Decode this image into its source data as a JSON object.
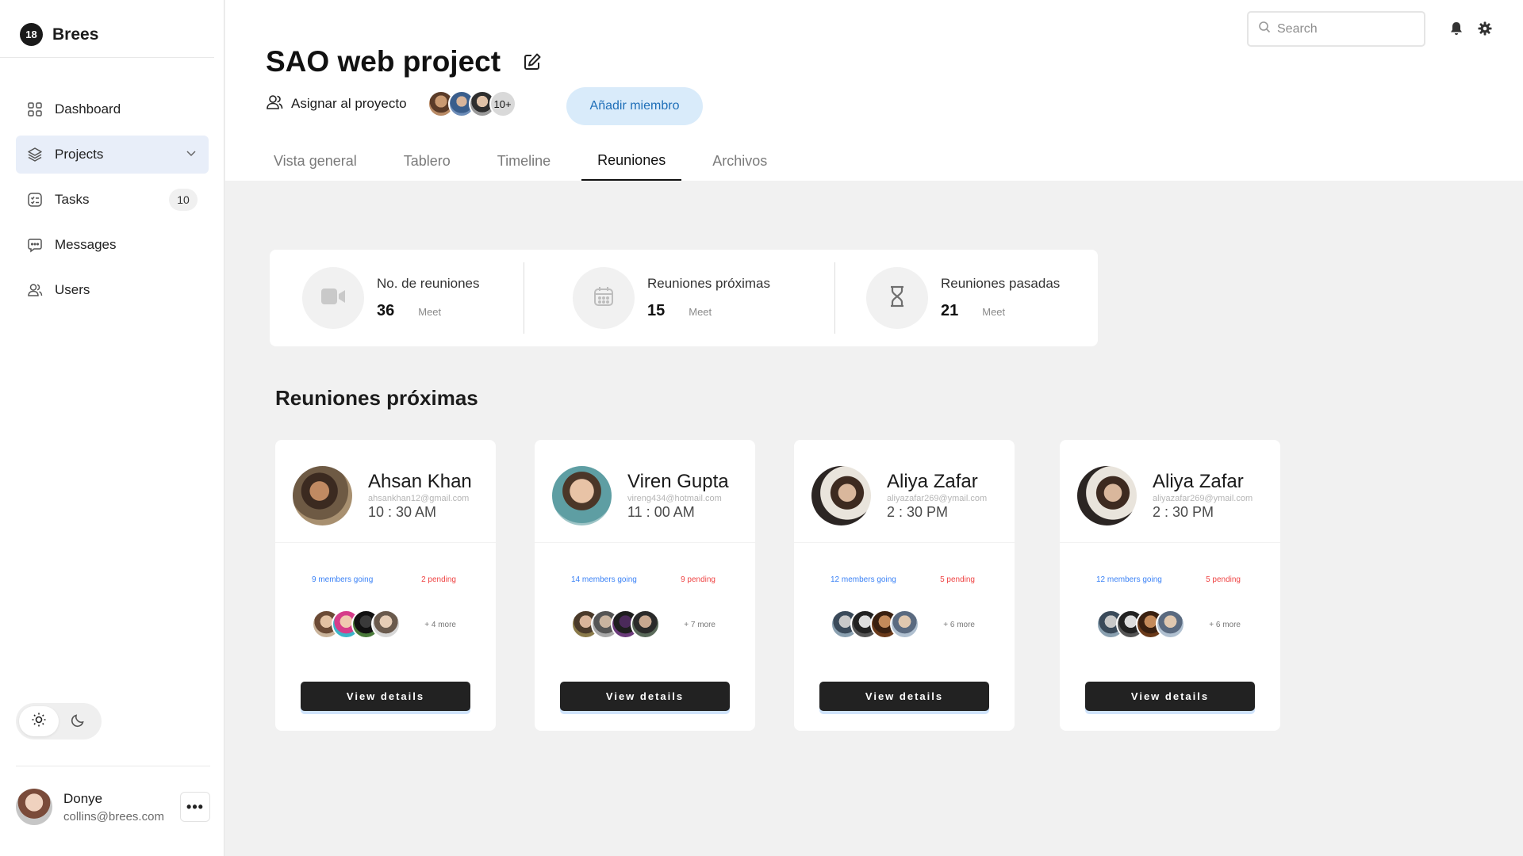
{
  "brand": {
    "logo": "18",
    "name": "Brees"
  },
  "sidebar": {
    "items": [
      {
        "label": "Dashboard",
        "icon": "dashboard-icon"
      },
      {
        "label": "Projects",
        "icon": "layers-icon",
        "active": true
      },
      {
        "label": "Tasks",
        "icon": "tasks-icon",
        "badge": "10"
      },
      {
        "label": "Messages",
        "icon": "messages-icon"
      },
      {
        "label": "Users",
        "icon": "users-icon"
      }
    ],
    "theme": {
      "selected": "light"
    }
  },
  "user": {
    "name": "Donye",
    "email": "collins@brees.com",
    "more": "•••"
  },
  "search": {
    "placeholder": "Search"
  },
  "project": {
    "title": "SAO web project",
    "assign_label": "Asignar al proyecto",
    "members_more": "10+",
    "add_member": "Añadir miembro"
  },
  "tabs": [
    "Vista general",
    "Tablero",
    "Timeline",
    "Reuniones",
    "Archivos"
  ],
  "active_tab": "Reuniones",
  "stats": [
    {
      "label": "No. de reuniones",
      "value": "36",
      "unit": "Meet",
      "icon": "video-icon"
    },
    {
      "label": "Reuniones próximas",
      "value": "15",
      "unit": "Meet",
      "icon": "calendar-icon"
    },
    {
      "label": "Reuniones pasadas",
      "value": "21",
      "unit": "Meet",
      "icon": "hourglass-icon"
    }
  ],
  "upcoming": {
    "title": "Reuniones próximas",
    "cards": [
      {
        "name": "Ahsan Khan",
        "email": "ahsankhan12@gmail.com",
        "time": "10 : 30 AM",
        "going": "9 members going",
        "pending": "2 pending",
        "more": "+ 4 more",
        "button": "View details"
      },
      {
        "name": "Viren Gupta",
        "email": "vireng434@hotmail.com",
        "time": "11 : 00 AM",
        "going": "14 members going",
        "pending": "9 pending",
        "more": "+ 7 more",
        "button": "View details"
      },
      {
        "name": "Aliya Zafar",
        "email": "aliyazafar269@ymail.com",
        "time": "2 : 30 PM",
        "going": "12 members going",
        "pending": "5 pending",
        "more": "+ 6 more",
        "button": "View details"
      },
      {
        "name": "Aliya Zafar",
        "email": "aliyazafar269@ymail.com",
        "time": "2 : 30 PM",
        "going": "12 members going",
        "pending": "5 pending",
        "more": "+ 6 more",
        "button": "View details"
      }
    ]
  },
  "colors": {
    "accent": "#3b82f6",
    "pending": "#ef4444",
    "active_nav": "#e8eef9",
    "button_dark": "#222222"
  }
}
